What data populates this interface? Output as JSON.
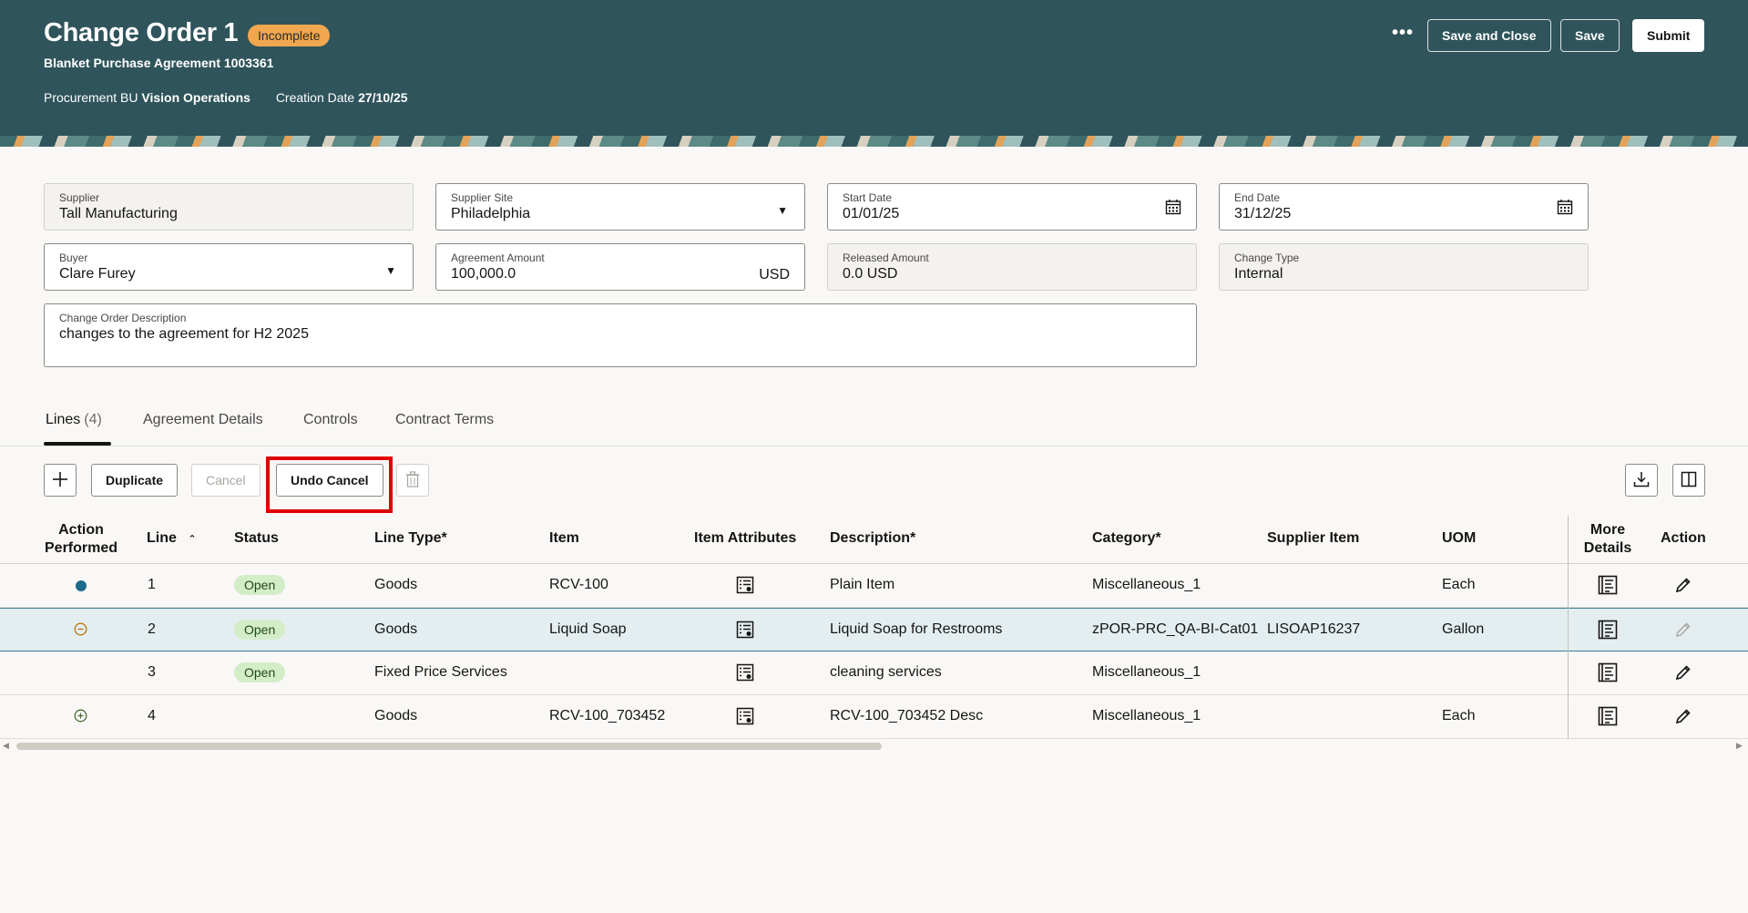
{
  "header": {
    "title": "Change Order 1",
    "status_badge": "Incomplete",
    "subtitle": "Blanket Purchase Agreement 1003361",
    "procurement_bu_label": "Procurement BU",
    "procurement_bu_value": "Vision Operations",
    "creation_date_label": "Creation Date",
    "creation_date_value": "27/10/25",
    "more_actions": "•••",
    "save_close_label": "Save and Close",
    "save_label": "Save",
    "submit_label": "Submit"
  },
  "form": {
    "supplier": {
      "label": "Supplier",
      "value": "Tall Manufacturing"
    },
    "supplier_site": {
      "label": "Supplier Site",
      "value": "Philadelphia"
    },
    "start_date": {
      "label": "Start Date",
      "value": "01/01/25"
    },
    "end_date": {
      "label": "End Date",
      "value": "31/12/25"
    },
    "buyer": {
      "label": "Buyer",
      "value": "Clare Furey"
    },
    "agreement_amount": {
      "label": "Agreement Amount",
      "value": "100,000.0",
      "currency": "USD"
    },
    "released_amount": {
      "label": "Released Amount",
      "value": "0.0 USD"
    },
    "change_type": {
      "label": "Change Type",
      "value": "Internal"
    },
    "description": {
      "label": "Change Order Description",
      "value": "changes to the agreement for H2 2025"
    }
  },
  "tabs": [
    {
      "label": "Lines",
      "count": "(4)"
    },
    {
      "label": "Agreement Details"
    },
    {
      "label": "Controls"
    },
    {
      "label": "Contract Terms"
    }
  ],
  "toolbar": {
    "add_icon": "plus-icon",
    "duplicate_label": "Duplicate",
    "cancel_label": "Cancel",
    "undo_cancel_label": "Undo Cancel",
    "delete_icon": "trash-icon",
    "download_icon": "download-icon",
    "columns_icon": "columns-icon"
  },
  "table": {
    "headers": {
      "action_performed_1": "Action",
      "action_performed_2": "Performed",
      "line": "Line",
      "status": "Status",
      "line_type": "Line Type*",
      "item": "Item",
      "item_attributes": "Item Attributes",
      "description": "Description*",
      "category": "Category*",
      "supplier_item": "Supplier Item",
      "uom": "UOM",
      "more_details_1": "More",
      "more_details_2": "Details",
      "action": "Action"
    },
    "rows": [
      {
        "action_icon": "dot-icon",
        "line": "1",
        "status": "Open",
        "line_type": "Goods",
        "item": "RCV-100",
        "description": "Plain Item",
        "category": "Miscellaneous_1",
        "supplier_item": "",
        "uom": "Each"
      },
      {
        "action_icon": "minus-circle-icon",
        "line": "2",
        "status": "Open",
        "line_type": "Goods",
        "item": "Liquid Soap",
        "description": "Liquid Soap for Restrooms",
        "category": "zPOR-PRC_QA-BI-Cat01",
        "supplier_item": "LISOAP16237",
        "uom": "Gallon"
      },
      {
        "action_icon": "",
        "line": "3",
        "status": "Open",
        "line_type": "Fixed Price Services",
        "item": "",
        "description": "cleaning services",
        "category": "Miscellaneous_1",
        "supplier_item": "",
        "uom": ""
      },
      {
        "action_icon": "plus-circle-icon",
        "line": "4",
        "status": "",
        "line_type": "Goods",
        "item": "RCV-100_703452",
        "description": "RCV-100_703452 Desc",
        "category": "Miscellaneous_1",
        "supplier_item": "",
        "uom": "Each"
      }
    ]
  },
  "colors": {
    "header_bg": "#2f545b",
    "badge_bg": "#f1a74f",
    "status_open_bg": "#d4edc9",
    "highlight_red": "#e00000",
    "selected_row_bg": "#e4eef1"
  }
}
